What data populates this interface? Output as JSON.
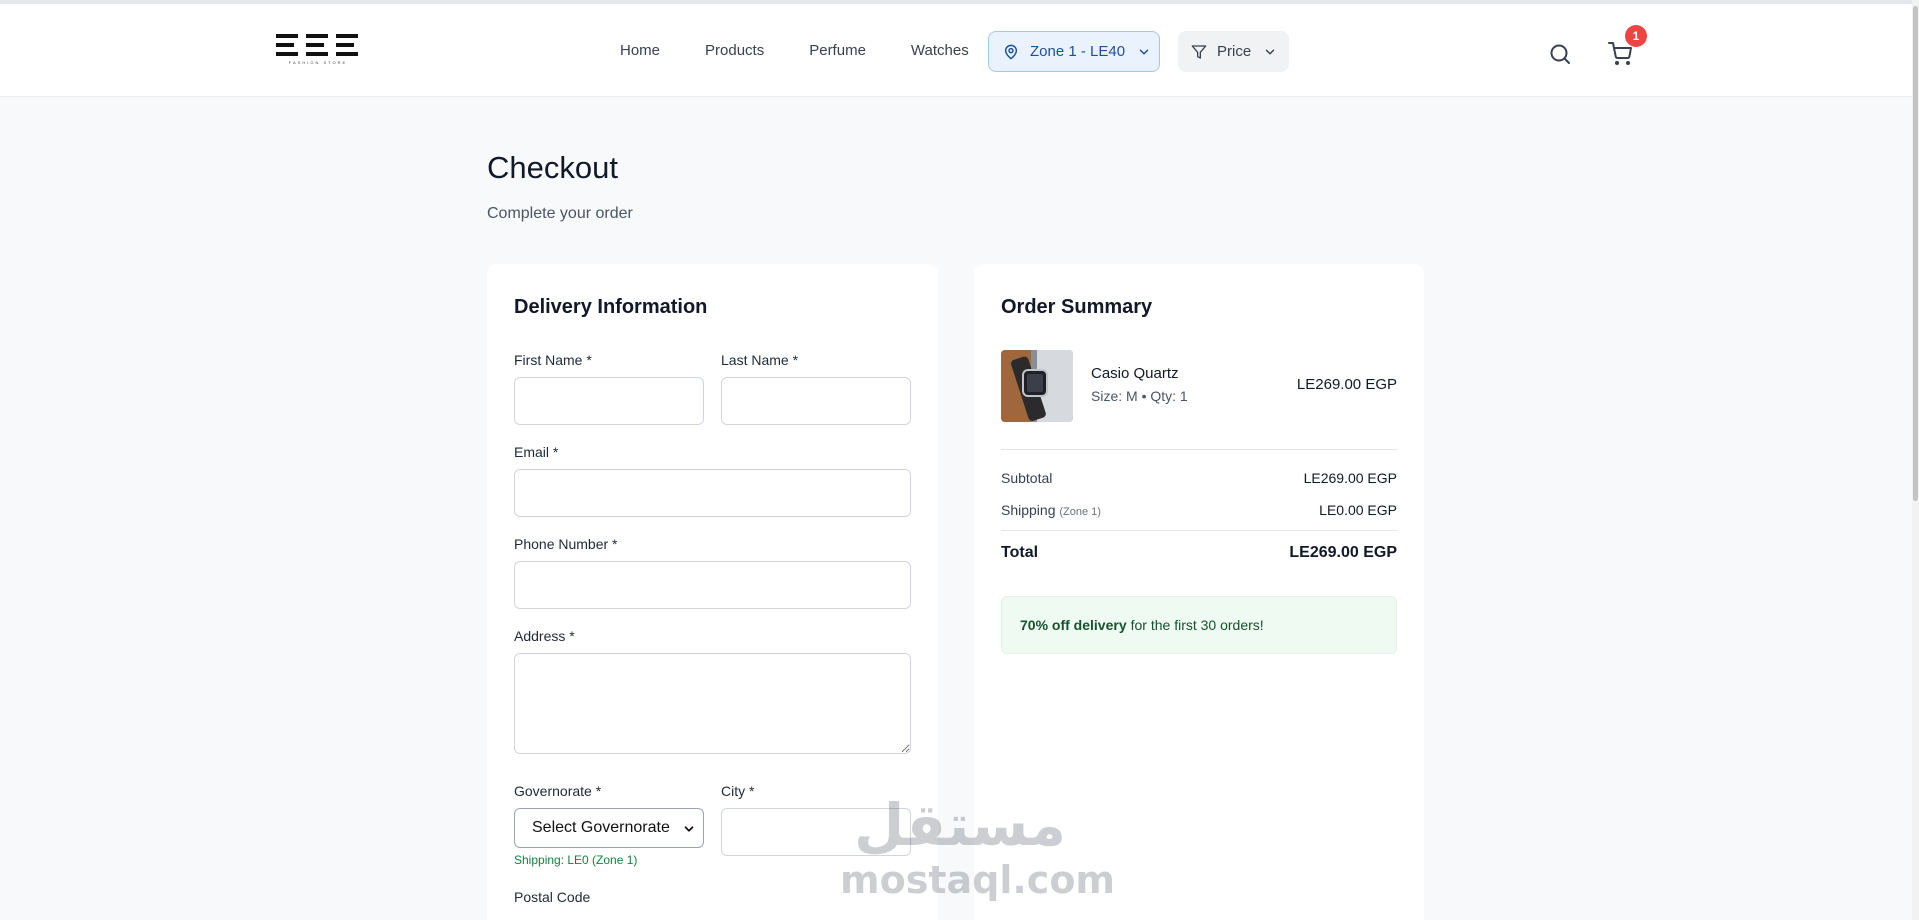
{
  "nav": {
    "items": [
      "Home",
      "Products",
      "Perfume",
      "Watches"
    ],
    "zone": "Zone 1 - LE40",
    "price": "Price",
    "cart_count": "1",
    "logo_tagline": "FASHION STORE"
  },
  "page": {
    "title": "Checkout",
    "subtitle": "Complete your order"
  },
  "delivery": {
    "title": "Delivery Information",
    "first_name": "First Name *",
    "last_name": "Last Name *",
    "email": "Email *",
    "phone": "Phone Number *",
    "address": "Address *",
    "governorate": "Governorate *",
    "governorate_value": "Select Governorate",
    "city": "City *",
    "shipping_note": "Shipping: LE0 (Zone 1)",
    "postal_code": "Postal Code"
  },
  "summary": {
    "title": "Order Summary",
    "item": {
      "name": "Casio Quartz",
      "meta": "Size: M • Qty: 1",
      "price": "LE269.00 EGP"
    },
    "subtotal_label": "Subtotal",
    "subtotal_value": "LE269.00 EGP",
    "shipping_label": "Shipping",
    "shipping_zone": "(Zone 1)",
    "shipping_value": "LE0.00 EGP",
    "total_label": "Total",
    "total_value": "LE269.00 EGP",
    "promo_bold": "70% off delivery",
    "promo_rest": "for the first 30 orders!"
  },
  "watermark": {
    "arabic": "مستقل",
    "latin": "mostaql.com"
  },
  "colors": {
    "accent_blue": "#1d4f9a",
    "badge_red": "#ef4444",
    "success_green": "#15803d"
  }
}
